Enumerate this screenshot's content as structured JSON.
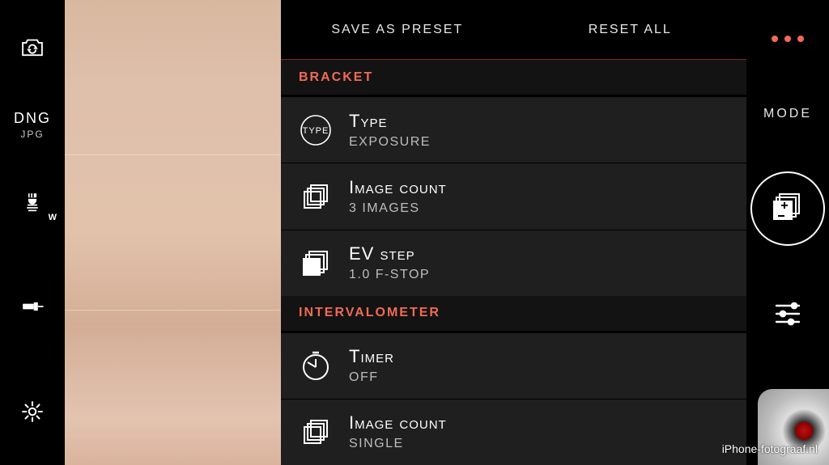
{
  "left_toolbar": {
    "format_line1": "DNG",
    "format_line2": "JPG",
    "wb_sub": "W"
  },
  "panel": {
    "header": {
      "save_preset": "SAVE AS PRESET",
      "reset_all": "RESET ALL"
    },
    "sections": {
      "bracket": {
        "title": "BRACKET",
        "rows": {
          "type": {
            "title": "Type",
            "value": "EXPOSURE",
            "icon_label": "TYPE"
          },
          "image_count": {
            "title": "Image count",
            "value": "3 IMAGES"
          },
          "ev_step": {
            "title": "EV step",
            "value": "1.0 F-STOP"
          }
        }
      },
      "intervalometer": {
        "title": "INTERVALOMETER",
        "rows": {
          "timer": {
            "title": "Timer",
            "value": "OFF"
          },
          "image_count": {
            "title": "Image count",
            "value": "SINGLE"
          }
        }
      }
    }
  },
  "right_bar": {
    "mode_label": "MODE"
  },
  "watermark": "iPhone-fotograaf.nl",
  "colors": {
    "accent": "#f36a54",
    "panel_bg": "#1f1f1f"
  }
}
